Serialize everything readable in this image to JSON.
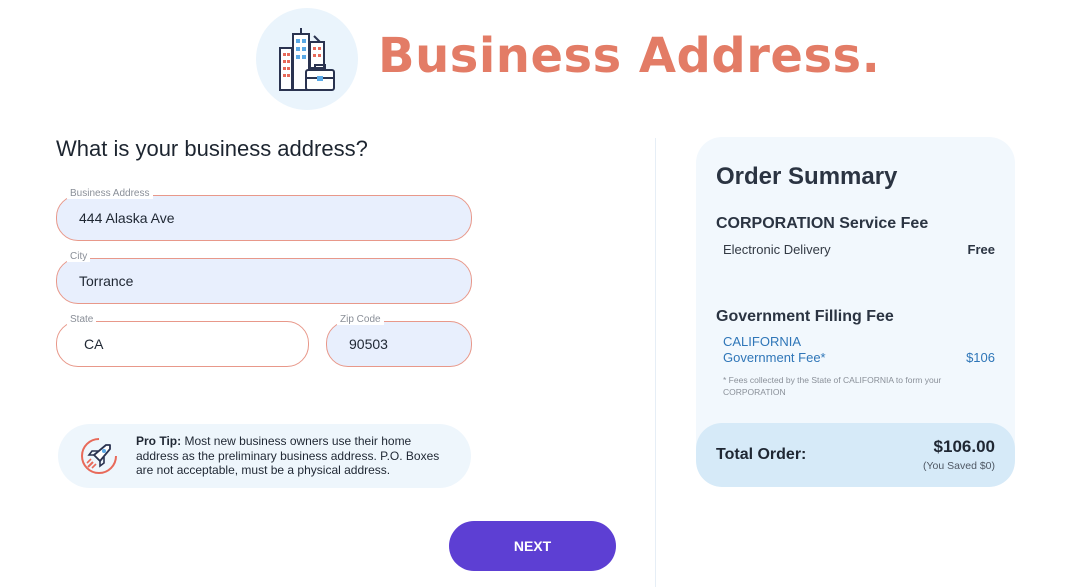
{
  "header": {
    "title": "Business Address.",
    "icon": "city-briefcase-icon"
  },
  "form": {
    "question": "What is your business address?",
    "address": {
      "label": "Business Address",
      "value": "444 Alaska Ave"
    },
    "city": {
      "label": "City",
      "value": "Torrance"
    },
    "state": {
      "label": "State",
      "value": "CA"
    },
    "zip": {
      "label": "Zip Code",
      "value": "90503"
    }
  },
  "pro_tip": {
    "icon": "rocket-icon",
    "heading": "Pro Tip:",
    "text": " Most new business owners use their home address as the preliminary business address. P.O. Boxes are not acceptable, must be a physical address."
  },
  "next_button": {
    "label": "NEXT"
  },
  "summary": {
    "title": "Order Summary",
    "service_fee": {
      "title": "CORPORATION Service Fee",
      "line_label": "Electronic Delivery",
      "line_value": "Free"
    },
    "government_fee": {
      "title": "Government Filling Fee",
      "state": "CALIFORNIA",
      "label": "Government Fee*",
      "value": "$106",
      "note": "* Fees collected by the State of CALIFORNIA to form your CORPORATION"
    },
    "total": {
      "label": "Total Order:",
      "amount": "$106.00",
      "saved": "(You Saved $0)"
    }
  },
  "colors": {
    "title": "#e37c66",
    "field_border": "#e8988a",
    "field_fill": "#e8effd",
    "primary_button": "#5d3fd3",
    "summary_bg": "#f2f8fd",
    "total_bg": "#d6eaf8",
    "link_blue": "#2f76b8"
  }
}
